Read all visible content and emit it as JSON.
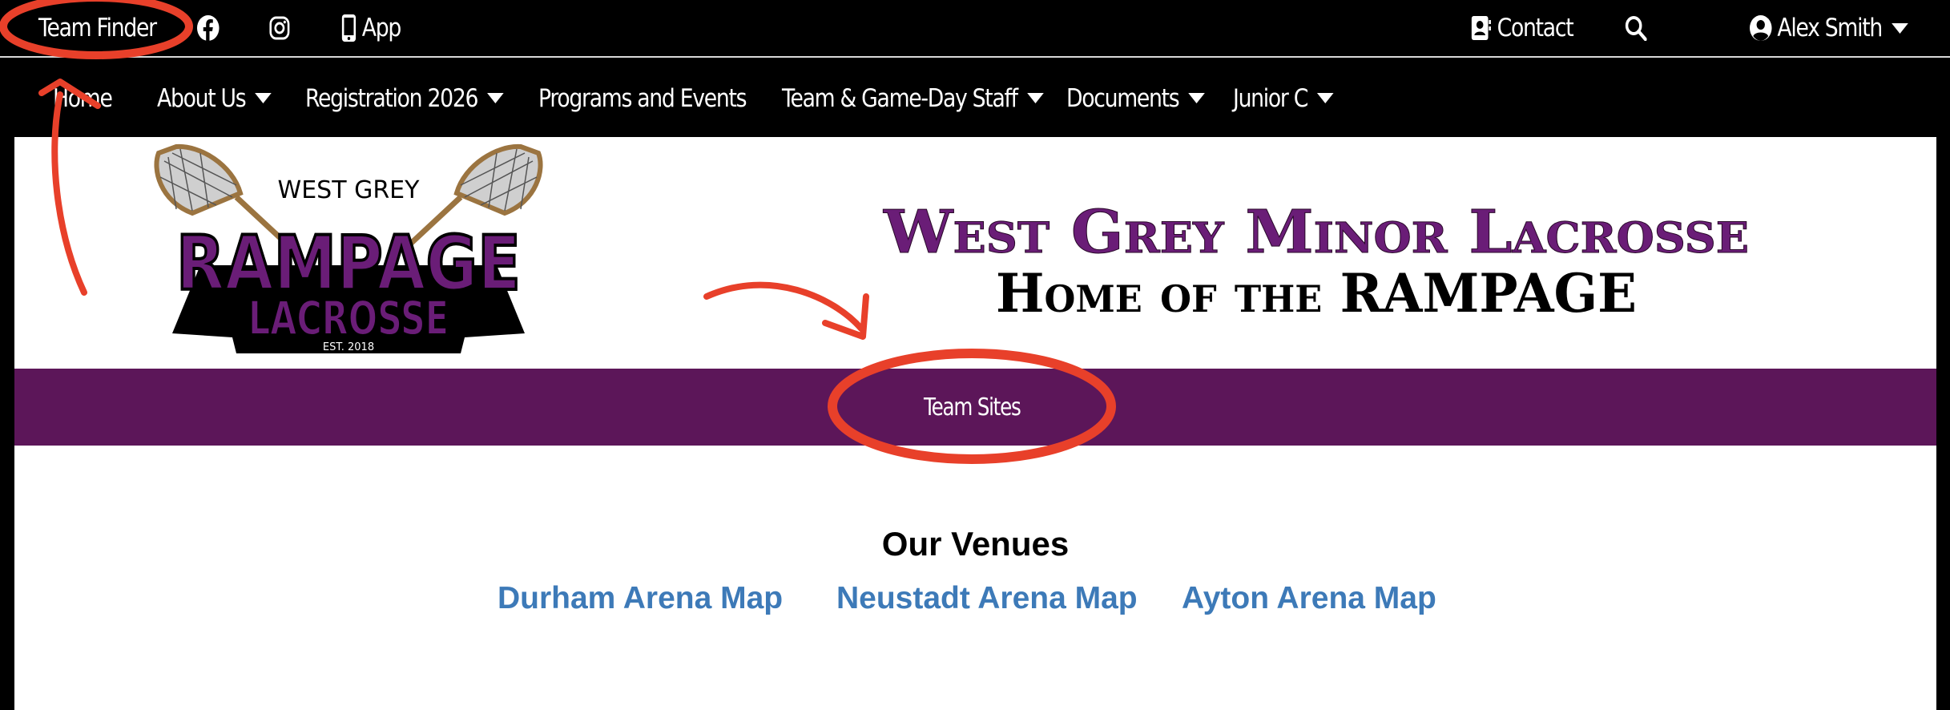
{
  "topbar": {
    "team_finder": "Team Finder",
    "app": "App",
    "contact": "Contact",
    "user_name": "Alex Smith",
    "icons": [
      "facebook-icon",
      "instagram-icon",
      "phone-icon",
      "contact-card-icon",
      "search-icon",
      "user-circle-icon"
    ]
  },
  "nav": {
    "items": [
      {
        "label": "Home"
      },
      {
        "label": "About Us",
        "dropdown": true
      },
      {
        "label": "Registration 2026",
        "dropdown": true
      },
      {
        "label": "Programs and Events"
      },
      {
        "label": "Team & Game-Day Staff",
        "dropdown": true
      },
      {
        "label": "Documents",
        "dropdown": true
      },
      {
        "label": "Junior C",
        "dropdown": true
      }
    ]
  },
  "logo": {
    "line1": "WEST GREY",
    "line2": "RAMPAGE",
    "line3": "LACROSSE",
    "est": "EST. 2018"
  },
  "banner": {
    "title": "West Grey Minor Lacrosse",
    "subtitle": "Home of the RAMPAGE"
  },
  "team_sites": "Team Sites",
  "venues": {
    "title": "Our Venues",
    "links": [
      "Durham Arena Map",
      "Neustadt Arena Map",
      "Ayton Arena Map"
    ]
  },
  "colors": {
    "purple": "#5c1659",
    "link_blue": "#3d7ab8",
    "annotation_red": "#e8402a"
  }
}
